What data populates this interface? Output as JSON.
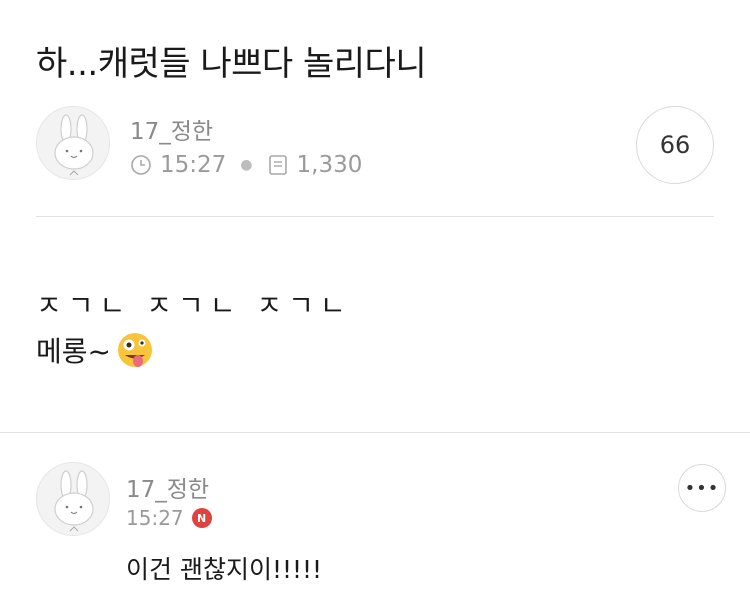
{
  "post": {
    "title": "하...캐럿들 나쁘다 놀리다니",
    "author": "17_정한",
    "time": "15:27",
    "views": "1,330",
    "comment_count": "66",
    "body_line1": "ㅈㄱㄴ ㅈㄱㄴ ㅈㄱㄴ",
    "body_line2": "메롱~",
    "body_emoji": "zany-face-emoji"
  },
  "comment": {
    "author": "17_정한",
    "time": "15:27",
    "new_badge": "N",
    "text": "이건 괜찮지이!!!!!",
    "more_label": "•••"
  },
  "icons": {
    "clock": "clock-icon",
    "document": "document-icon",
    "avatar": "bunny-avatar"
  },
  "colors": {
    "new_badge": "#e0423f",
    "meta_text": "#9a9a9a",
    "divider": "#e2e2e2"
  }
}
